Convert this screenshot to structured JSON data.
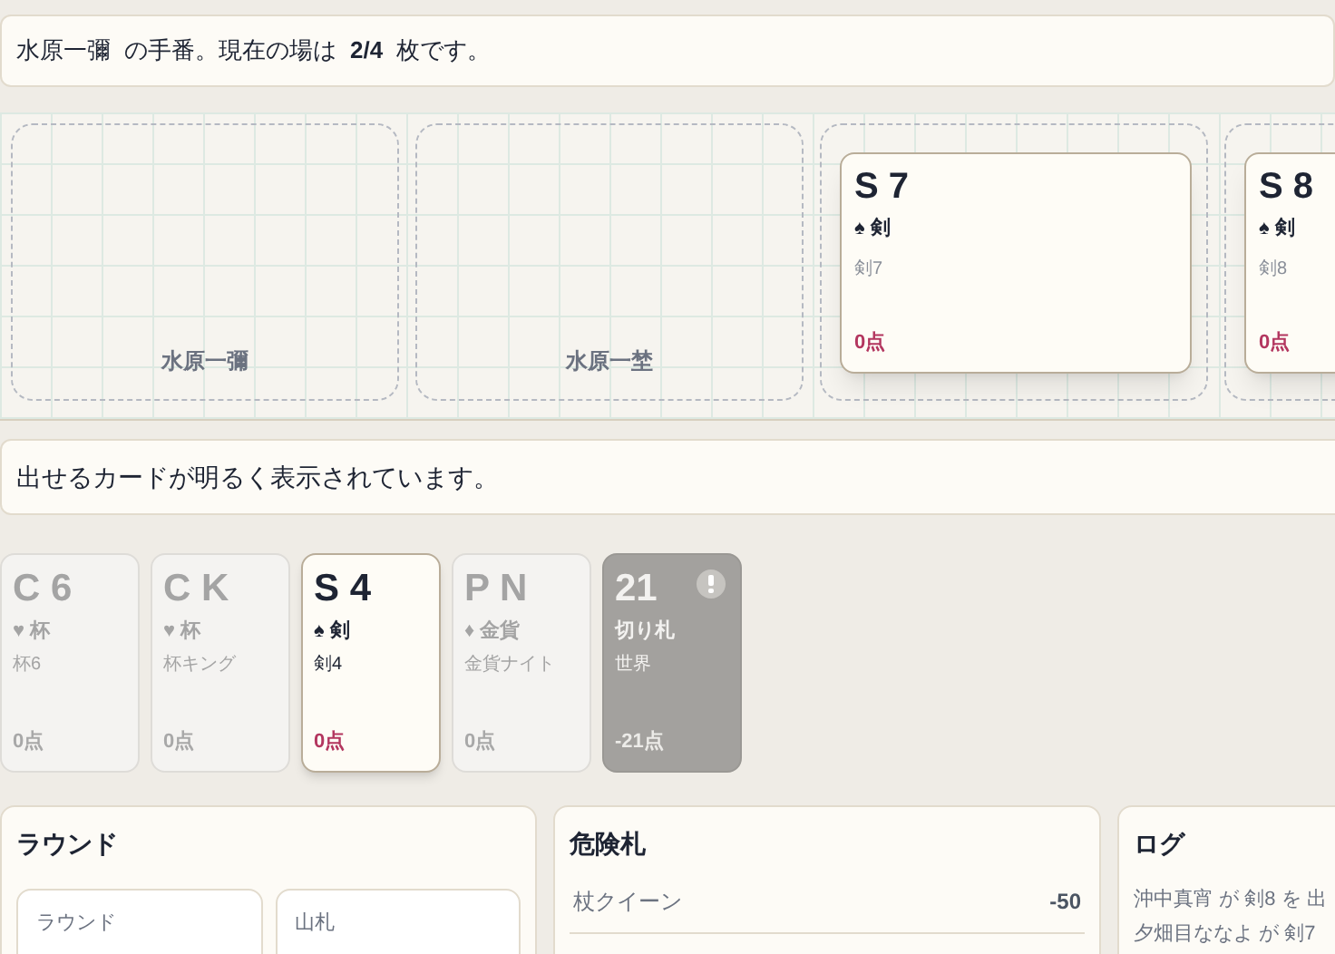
{
  "status": "水原一彌 の手番。現在の場は **2/4** 枚です。",
  "slots": [
    {
      "kind": "empty",
      "player": "水原一彌"
    },
    {
      "kind": "empty",
      "player": "水原一埜"
    },
    {
      "kind": "played",
      "card": {
        "rank": "S 7",
        "suit": "♠ 剣",
        "name": "剣7",
        "points": "0点"
      }
    },
    {
      "kind": "played",
      "card": {
        "rank": "S 8",
        "suit": "♠ 剣",
        "name": "剣8",
        "points": "0点"
      }
    }
  ],
  "hint": "出せるカードが明るく表示されています。",
  "hand": [
    {
      "kind": "suit",
      "rank": "C 6",
      "suit": "♥ 杯",
      "name": "杯6",
      "points": "0点",
      "playable": false
    },
    {
      "kind": "suit",
      "rank": "C K",
      "suit": "♥ 杯",
      "name": "杯キング",
      "points": "0点",
      "playable": false
    },
    {
      "kind": "suit",
      "rank": "S 4",
      "suit": "♠ 剣",
      "name": "剣4",
      "points": "0点",
      "playable": true
    },
    {
      "kind": "suit",
      "rank": "P N",
      "suit": "♦ 金貨",
      "name": "金貨ナイト",
      "points": "0点",
      "playable": false
    },
    {
      "kind": "trump",
      "rank": "21",
      "suit": "切り札",
      "name": "世界",
      "points": "-21点",
      "playable": false
    }
  ],
  "round_panel": {
    "title": "ラウンド",
    "stats": [
      {
        "label": "ラウンド"
      },
      {
        "label": "山札"
      }
    ]
  },
  "danger_panel": {
    "title": "危険札",
    "rows": [
      {
        "name": "杖クイーン",
        "value": "-50"
      }
    ]
  },
  "log_panel": {
    "title": "ログ",
    "entries": [
      "沖中真宵 が 剣8 を 出",
      "夕畑目ななよ が 剣7"
    ]
  }
}
